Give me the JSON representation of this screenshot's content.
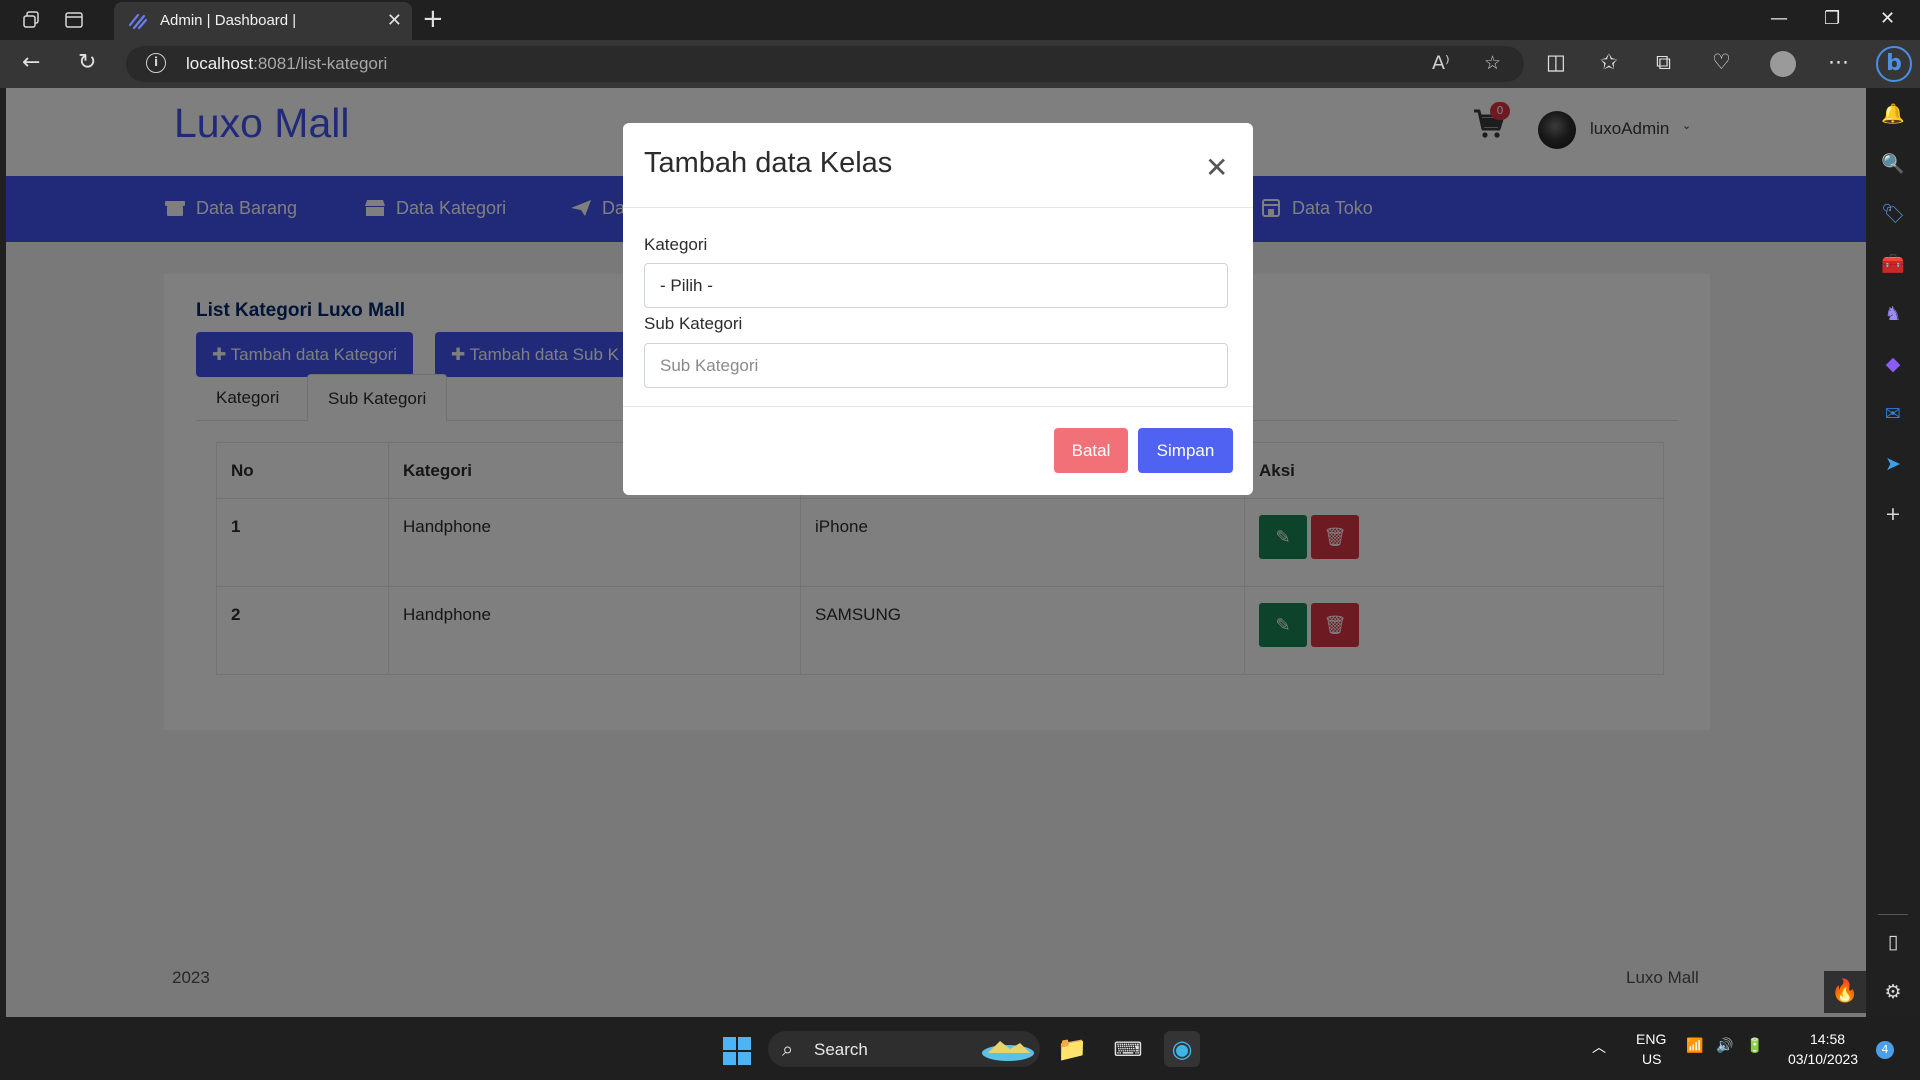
{
  "browser": {
    "tab_title": "Admin | Dashboard |",
    "url_host": "localhost",
    "url_path": ":8081/list-kategori"
  },
  "site": {
    "brand": "Luxo Mall",
    "cart_count": "0",
    "username": "luxoAdmin"
  },
  "nav": {
    "items": [
      {
        "label": "Data Barang",
        "icon": "box-icon"
      },
      {
        "label": "Data Kategori",
        "icon": "store-icon"
      },
      {
        "label": "Da",
        "icon": "send-icon"
      },
      {
        "label": "Data Toko",
        "icon": "shop-icon"
      }
    ]
  },
  "card": {
    "title": "List Kategori Luxo Mall",
    "btn_add_kategori": "Tambah data Kategori",
    "btn_add_sub": "Tambah data Sub K",
    "tabs": [
      "Kategori",
      "Sub Kategori"
    ],
    "active_tab": "Sub Kategori"
  },
  "table": {
    "headers": [
      "No",
      "Kategori",
      "",
      "Aksi"
    ],
    "rows": [
      {
        "no": "1",
        "kategori": "Handphone",
        "sub": "iPhone"
      },
      {
        "no": "2",
        "kategori": "Handphone",
        "sub": "SAMSUNG"
      }
    ]
  },
  "modal": {
    "title": "Tambah data Kelas",
    "label_kategori": "Kategori",
    "select_value": "- Pilih -",
    "label_sub": "Sub Kategori",
    "sub_placeholder": "Sub Kategori",
    "btn_cancel": "Batal",
    "btn_save": "Simpan"
  },
  "footer": {
    "year": "2023",
    "brand": "Luxo Mall"
  },
  "taskbar": {
    "search": "Search",
    "lang_top": "ENG",
    "lang_bottom": "US",
    "time": "14:58",
    "date": "03/10/2023",
    "notif_count": "4"
  },
  "colors": {
    "brand": "#4154f1",
    "edit": "#198754",
    "delete": "#dc3545",
    "cancel": "#f27179",
    "save": "#4f62f1"
  }
}
